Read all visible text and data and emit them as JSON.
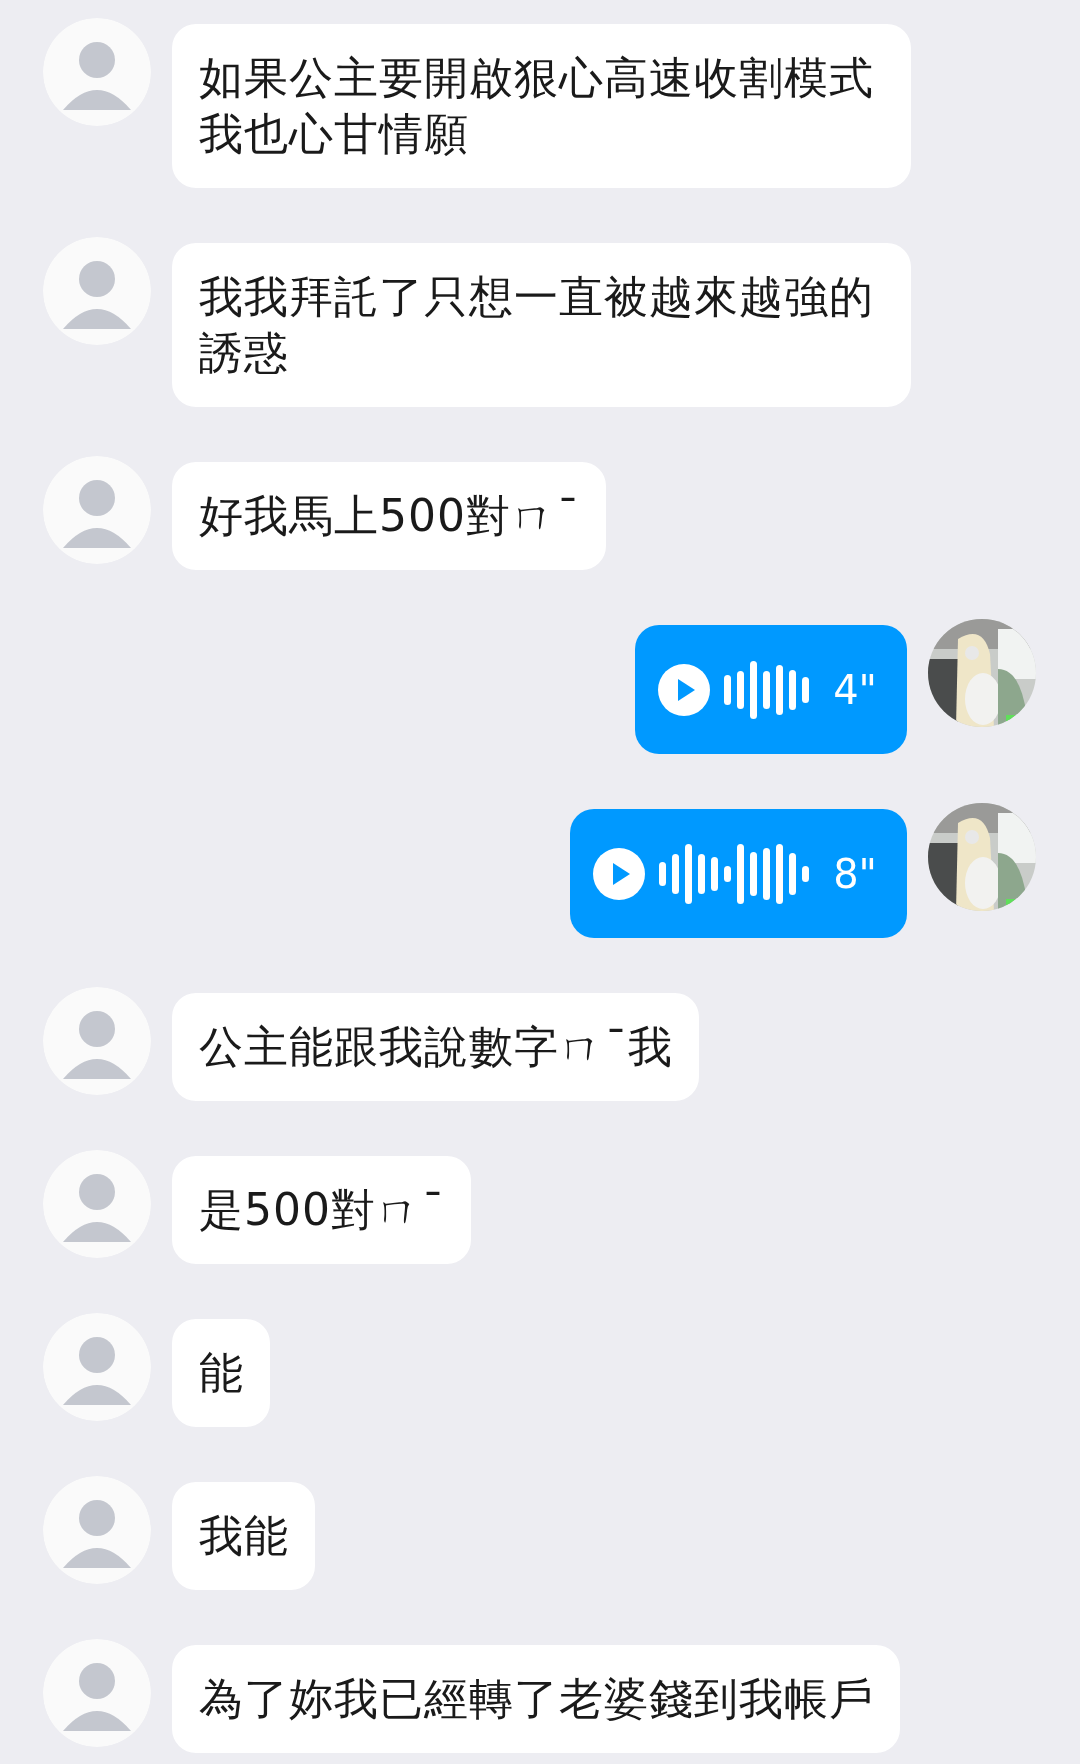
{
  "messages": [
    {
      "kind": "text",
      "outgoing": false,
      "text": "如果公主要開啟狠心高速收割模式我也心甘情願"
    },
    {
      "kind": "text",
      "outgoing": false,
      "text": "我我拜託了只想一直被越來越強的誘惑"
    },
    {
      "kind": "text",
      "outgoing": false,
      "text": "好我馬上500對ㄇˉ"
    },
    {
      "kind": "voice",
      "outgoing": true,
      "duration": "4\""
    },
    {
      "kind": "voice",
      "outgoing": true,
      "duration": "8\""
    },
    {
      "kind": "text",
      "outgoing": false,
      "text": "公主能跟我說數字ㄇˉ我"
    },
    {
      "kind": "text",
      "outgoing": false,
      "text": "是500對ㄇˉ"
    },
    {
      "kind": "text",
      "outgoing": false,
      "text": "能"
    },
    {
      "kind": "text",
      "outgoing": false,
      "text": "我能"
    },
    {
      "kind": "text",
      "outgoing": false,
      "text": "為了妳我已經轉了老婆錢到我帳戶"
    }
  ]
}
